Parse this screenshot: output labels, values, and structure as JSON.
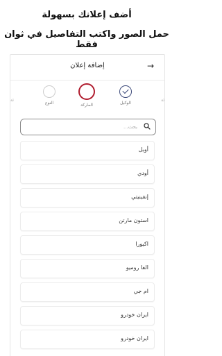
{
  "promo": {
    "line1": "أضف إعلانك بسهولة",
    "line2": "حمل الصور واكتب التفاصيل في ثوان فقط"
  },
  "appbar": {
    "title": "إضافة إعلان",
    "back_icon": "arrow-right-icon"
  },
  "steps": {
    "edge_left": "ئة",
    "edge_right": "ئة",
    "items": [
      {
        "label": "النوع",
        "state": "pending"
      },
      {
        "label": "الماركة",
        "state": "active"
      },
      {
        "label": "الوكيل",
        "state": "done"
      }
    ]
  },
  "search": {
    "placeholder": "بحث...",
    "icon": "search-icon"
  },
  "brands": [
    "أوبل",
    "أودي",
    "إنفينيتي",
    "استون مارتن",
    "اكيورا",
    "الفا روميو",
    "ام جي",
    "ايران خودرو",
    "ايران خودرو"
  ],
  "colors": {
    "active_step": "#b01c2e",
    "done_step": "#3d4a7a"
  }
}
